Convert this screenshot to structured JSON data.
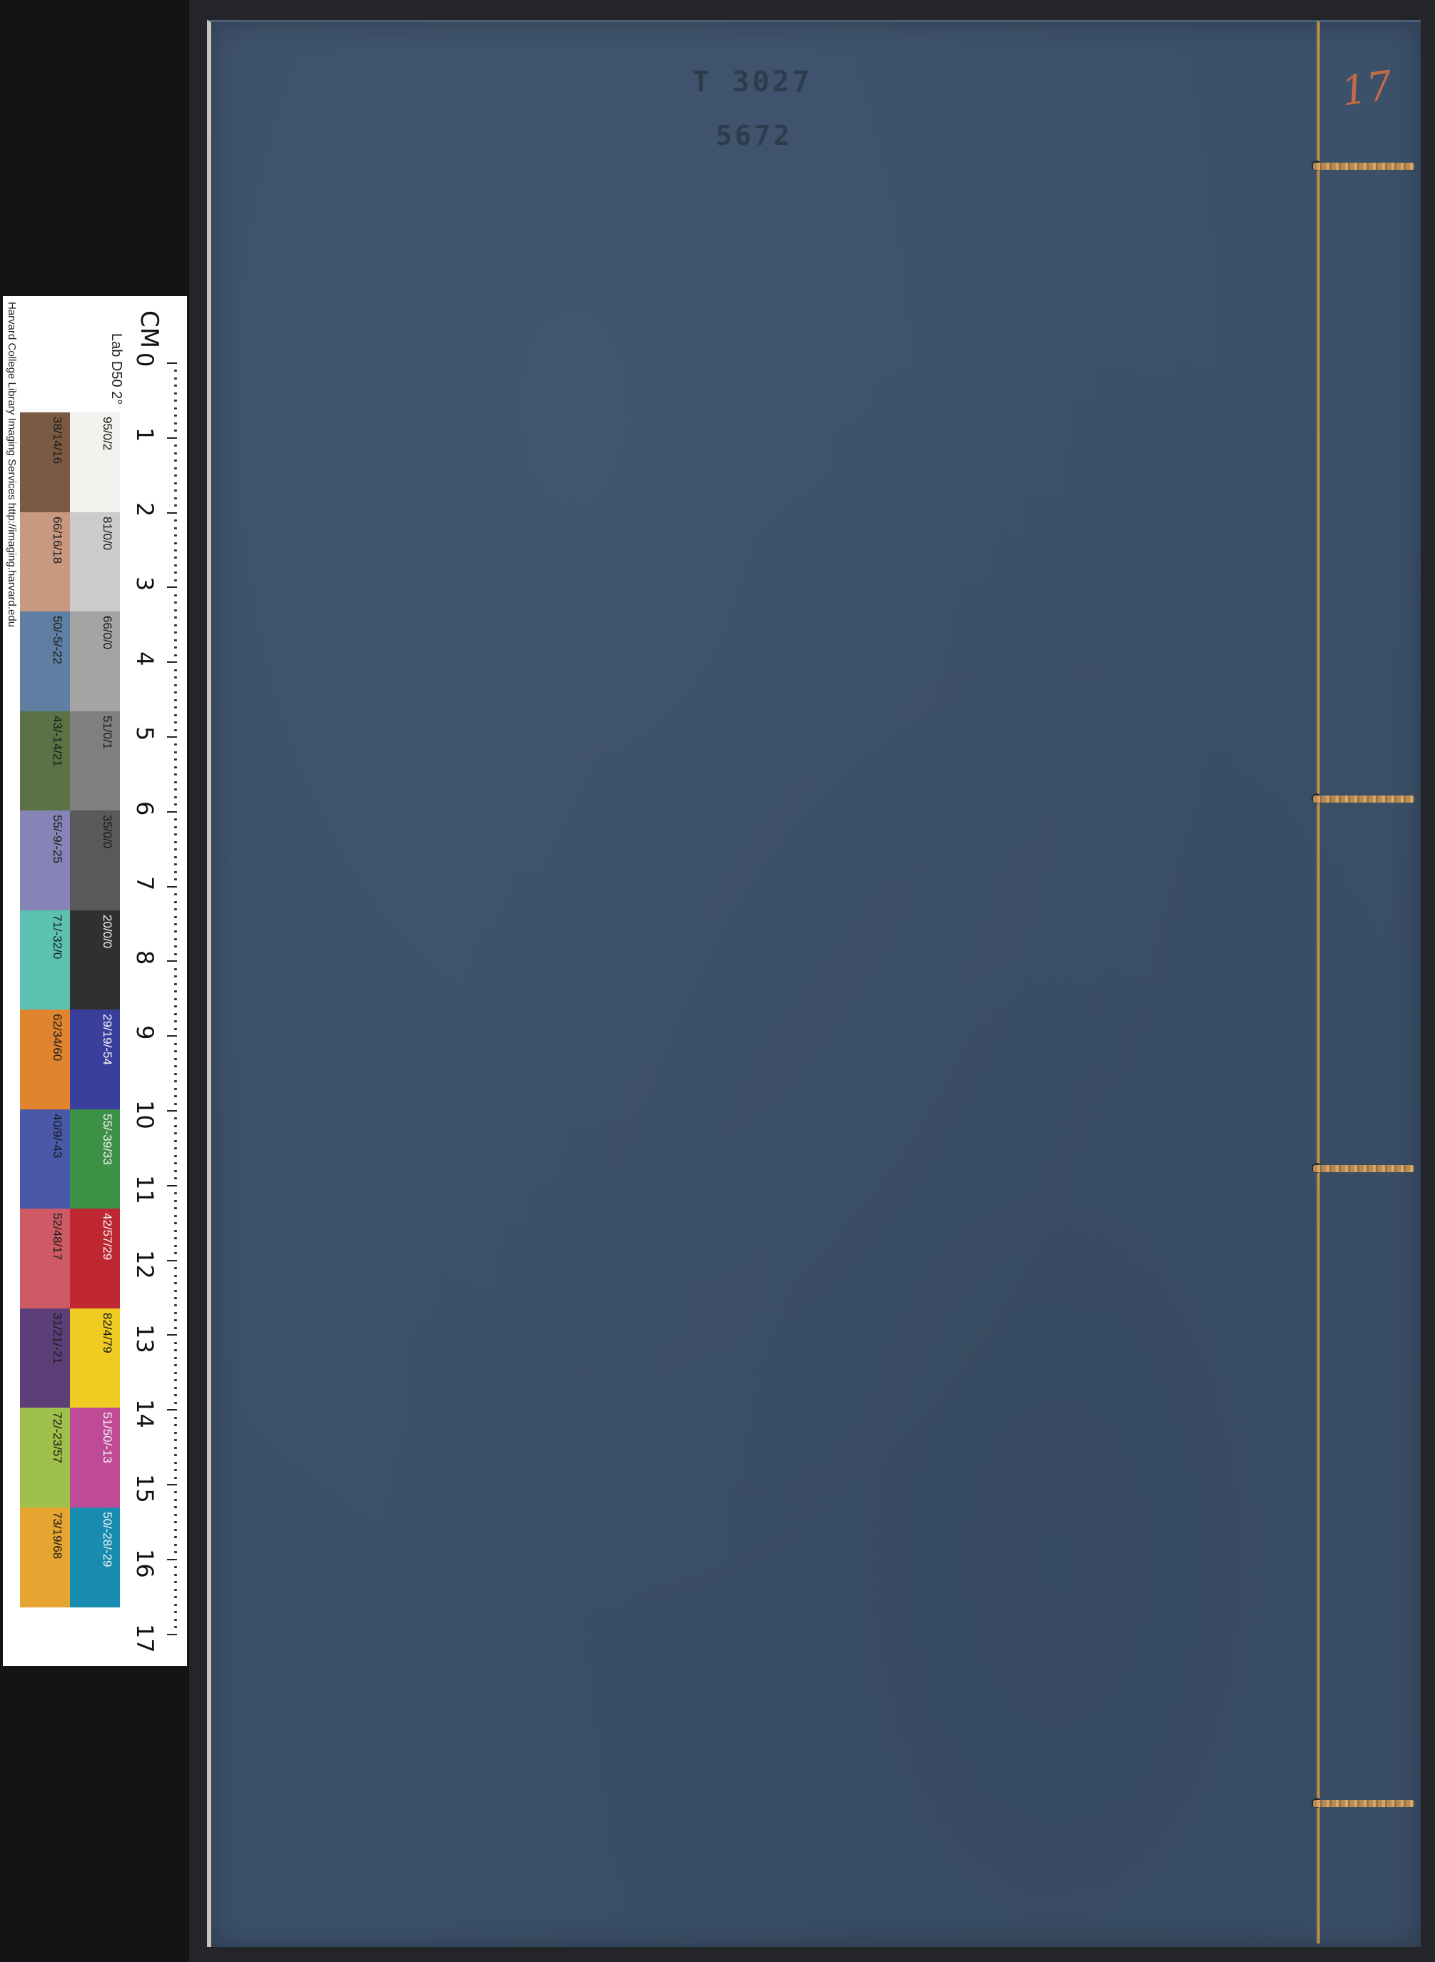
{
  "cover": {
    "stamp_line_1": "T 3027",
    "stamp_line_2": "5672",
    "folio_mark": "17"
  },
  "color_card": {
    "credit": "Harvard College Library Imaging Services http://imaging.harvard.edu",
    "unit_label": "CM",
    "lab_label": "Lab D50 2°",
    "ruler_numbers": [
      "0",
      "1",
      "2",
      "3",
      "4",
      "5",
      "6",
      "7",
      "8",
      "9",
      "10",
      "11",
      "12",
      "13",
      "14",
      "15",
      "16",
      "17"
    ],
    "color_column": [
      {
        "label": "38/14/16",
        "color": "#7a5a43"
      },
      {
        "label": "66/16/18",
        "color": "#c99880"
      },
      {
        "label": "50/-5/-22",
        "color": "#5f7ea2"
      },
      {
        "label": "43/-14/21",
        "color": "#5a7246"
      },
      {
        "label": "55/-9/-25",
        "color": "#8683b6"
      },
      {
        "label": "71/-32/0",
        "color": "#5cc1b1"
      },
      {
        "label": "62/34/60",
        "color": "#e08430"
      },
      {
        "label": "40/9/-43",
        "color": "#4959a8"
      },
      {
        "label": "52/48/17",
        "color": "#ce5a66"
      },
      {
        "label": "31/21/-21",
        "color": "#5c3f78"
      },
      {
        "label": "72/-23/57",
        "color": "#9fc04a"
      },
      {
        "label": "73/19/68",
        "color": "#e6a531"
      }
    ],
    "gray_column": [
      {
        "label": "95/0/2",
        "color": "#f2f2ee"
      },
      {
        "label": "81/0/0",
        "color": "#cccccc"
      },
      {
        "label": "66/0/0",
        "color": "#a4a4a4"
      },
      {
        "label": "51/0/1",
        "color": "#7f7f7e"
      },
      {
        "label": "35/0/0",
        "color": "#595959"
      },
      {
        "label": "20/0/0",
        "color": "#303030"
      },
      {
        "label": "29/19/-54",
        "color": "#3a3f9c"
      },
      {
        "label": "55/-39/33",
        "color": "#3d9146"
      },
      {
        "label": "42/57/29",
        "color": "#bf2832"
      },
      {
        "label": "82/4/79",
        "color": "#f0cc22"
      },
      {
        "label": "51/50/-13",
        "color": "#bf4b96"
      },
      {
        "label": "50/-28/-29",
        "color": "#178bb0"
      }
    ]
  },
  "colors": {
    "cover_blue": "#3b5069",
    "binding_thread": "#c79a5a",
    "background": "#232528"
  }
}
